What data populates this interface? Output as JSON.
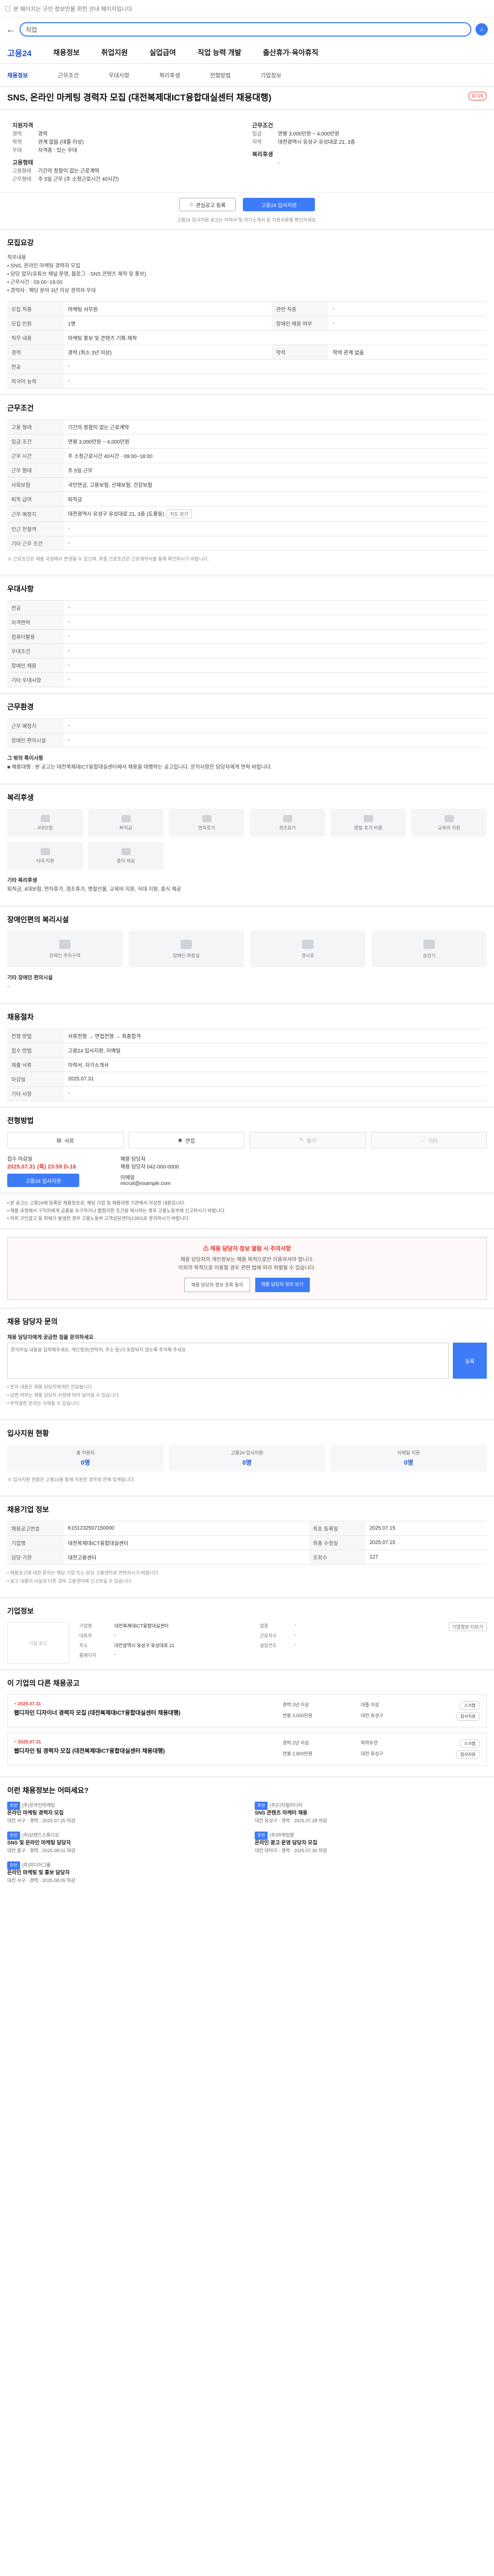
{
  "topbar": {
    "notice": "본 페이지는 구인 정보만을 위한 안내 페이지입니다"
  },
  "search": {
    "value": "직업"
  },
  "gnb": {
    "logo": "고용24",
    "items": [
      "채용정보",
      "취업지원",
      "실업급여",
      "직업 능력 개발",
      "출산휴가·육아휴직"
    ]
  },
  "subnav": {
    "items": [
      "채용정보",
      "근무조건",
      "우대사항",
      "복리후생",
      "전형방법",
      "기업정보"
    ]
  },
  "title": {
    "text": "SNS, 온라인 마케팅 경력자 모집 (대전복제대ICT융합대실센터 채용대행)",
    "dday": "D-16"
  },
  "summary": {
    "left_title": "지원자격",
    "left": [
      {
        "k": "경력",
        "v": "경력"
      },
      {
        "k": "학력",
        "v": "관계 없음 (대졸 이상)"
      },
      {
        "k": "우대",
        "v": "자격증 : 있는 우대"
      }
    ],
    "left2_title": "고용형태",
    "left2": [
      {
        "k": "고용형태",
        "v": "기간의 정함이 없는 근로계약"
      },
      {
        "k": "근무형태",
        "v": "주 5일 근무 (주 소정근로시간 40시간)"
      }
    ],
    "right_title": "근무조건",
    "right": [
      {
        "k": "임금",
        "v": "연봉 3,000만원 ~ 4,000만원"
      },
      {
        "k": "지역",
        "v": "대전광역시 유성구 유성대로 21, 3층"
      }
    ],
    "right2_title": "복리후생",
    "right2": [
      {
        "k": "",
        "v": "-"
      }
    ]
  },
  "apply": {
    "scrap": "관심공고 등록",
    "apply": "고용24 입사지원",
    "note": "고용24 입사지원 공고는 이력서 및 자기소개서 등 지원서류를 확인하세요."
  },
  "sections": {
    "recruit": {
      "title": "모집요강",
      "desc": [
        "직무내용",
        "• SNS, 온라인 마케팅 경력자 모집",
        "• 담당 업무(유튜브 채널 운영, 블로그 · SNS 콘텐츠 제작 및 홍보)",
        "• 근무시간 : 09:00~18:00",
        "• 경력자 : 해당 분야 3년 이상 경력자 우대"
      ],
      "rows": [
        {
          "k": "모집 직종",
          "v": "마케팅 사무원",
          "k2": "관련 직종",
          "v2": "-"
        },
        {
          "k": "모집 인원",
          "v": "1명",
          "k2": "장애인 채용 여부",
          "v2": "-"
        },
        {
          "k": "직무 내용",
          "v": "마케팅 홍보 및 콘텐츠 기획·제작",
          "k2": "",
          "v2": ""
        },
        {
          "k": "경력",
          "v": "경력 (최소 3년 이상)",
          "k2": "학력",
          "v2": "학력 관계 없음"
        },
        {
          "k": "전공",
          "v": "-",
          "k2": "",
          "v2": ""
        },
        {
          "k": "외국어 능력",
          "v": "-",
          "k2": "",
          "v2": ""
        }
      ]
    },
    "condition": {
      "title": "근무조건",
      "rows": [
        {
          "k": "고용 형태",
          "v": "기간의 정함이 없는 근로계약"
        },
        {
          "k": "임금 조건",
          "v": "연봉 3,000만원 ~ 4,000만원"
        },
        {
          "k": "근무 시간",
          "v": "주 소정근로시간 40시간 · 09:00~18:00"
        },
        {
          "k": "근무 형태",
          "v": "주 5일 근무"
        },
        {
          "k": "사회보험",
          "v": "국민연금, 고용보험, 산재보험, 건강보험"
        },
        {
          "k": "퇴직 급여",
          "v": "퇴직금"
        },
        {
          "k": "근무 예정지",
          "v": "대전광역시 유성구 유성대로 21, 3층 (도룡동)"
        },
        {
          "k": "인근 전철역",
          "v": "-"
        },
        {
          "k": "기타 근무 조건",
          "v": "-"
        }
      ],
      "note": "※ 근로조건은 채용 과정에서 변경될 수 있으며, 최종 근로조건은 근로계약서를 통해 확인하시기 바랍니다."
    },
    "prefer": {
      "title": "우대사항",
      "rows": [
        {
          "k": "전공",
          "v": "-"
        },
        {
          "k": "자격면허",
          "v": "-"
        },
        {
          "k": "컴퓨터활용",
          "v": "-"
        },
        {
          "k": "우대조건",
          "v": "-"
        },
        {
          "k": "장애인 채용",
          "v": "-"
        },
        {
          "k": "기타 우대사항",
          "v": "-"
        }
      ]
    },
    "env": {
      "title": "근무환경",
      "rows": [
        {
          "k": "근무 예정지",
          "v": "-"
        },
        {
          "k": "장애인 편의시설",
          "v": "-"
        }
      ],
      "sub": "그 밖의 특이사항",
      "sub_text": "■ 채용대행 : 본 공고는 대전복제대ICT융합대실센터에서 채용을 대행하는 공고입니다. 문의사항은 담당자에게 연락 바랍니다."
    },
    "welfare": {
      "title": "복리후생",
      "icons": [
        "4대보험",
        "퇴직금",
        "연차휴가",
        "경조휴가",
        "명절·휴가 비용",
        "교육비 지원",
        "식대 지원",
        "중식 제공"
      ],
      "sub": "기타 복리후생",
      "sub_text": "퇴직금, 4대보험, 연차휴가, 경조휴가, 명절선물, 교육비 지원, 식대 지원, 중식 제공"
    },
    "disabled": {
      "title": "장애인편의 복리시설",
      "icons": [
        "장애인 주차구역",
        "장애인 화장실",
        "경사로",
        "승강기"
      ],
      "sub": "기타 장애인 편의시설",
      "sub_text": "-"
    },
    "process": {
      "title": "채용절차",
      "rows": [
        {
          "k": "전형 방법",
          "v": "서류전형 → 면접전형 → 최종합격"
        },
        {
          "k": "접수 방법",
          "v": "고용24 입사지원, 이메일"
        },
        {
          "k": "제출 서류",
          "v": "이력서, 자기소개서"
        },
        {
          "k": "마감일",
          "v": "2025.07.31"
        },
        {
          "k": "기타 사항",
          "v": "-"
        }
      ]
    },
    "apply_method": {
      "title": "전형방법",
      "methods": [
        {
          "label": "서류",
          "off": false
        },
        {
          "label": "면접",
          "off": false
        },
        {
          "label": "필기",
          "off": true
        },
        {
          "label": "기타",
          "off": true
        }
      ],
      "deadline_label": "접수 마감일",
      "deadline": "2025.07.31 (목) 23:59",
      "dday": "D-16",
      "apply_btn": "고용24 입사지원",
      "contact_label": "채용 담당자",
      "contact": "채용 담당자 042-000-0000",
      "email_label": "이메일",
      "email": "recruit@example.com"
    },
    "notices": [
      "• 본 공고는 고용24에 등록된 채용정보로, 해당 기업 및 채용대행 기관에서 작성한 내용입니다.",
      "• 채용 과정에서 구직자에게 금품을 요구하거나 불합리한 조건을 제시하는 경우 고용노동부에 신고하시기 바랍니다.",
      "• 허위 구인광고 등 피해가 발생한 경우 고용노동부 고객상담센터(1350)로 문의하시기 바랍니다."
    ],
    "warning": {
      "title": "채용 담당자 정보 열람 시 주의사항",
      "text1": "채용 담당자의 개인정보는 채용 목적으로만 이용하셔야 합니다.",
      "text2": "이외의 목적으로 이용할 경우 관련 법에 따라 처벌될 수 있습니다.",
      "btn1": "채용 담당자 정보 조회 동의",
      "btn2": "채용 담당자 정보 보기"
    },
    "qna": {
      "title": "채용 담당자 문의",
      "label": "채용 담당자에게 궁금한 점을 문의하세요",
      "placeholder": "문의하실 내용을 입력해주세요. 개인정보(연락처, 주소 등)가 포함되지 않도록 주의해 주세요.",
      "register": "등록",
      "notes": [
        "• 문의 내용은 채용 담당자에게만 전달됩니다.",
        "• 답변 여부는 채용 담당자 사정에 따라 달라질 수 있습니다.",
        "• 부적절한 문의는 삭제될 수 있습니다."
      ]
    },
    "stats": {
      "title": "입사지원 현황",
      "items": [
        {
          "label": "총 지원자",
          "value": "0명"
        },
        {
          "label": "고용24 입사지원",
          "value": "0명"
        },
        {
          "label": "이메일 지원",
          "value": "0명"
        }
      ],
      "note": "※ 입사지원 현황은 고용24를 통해 지원한 경우에 한해 집계됩니다."
    },
    "info": {
      "title": "채용기업 정보",
      "rows": [
        {
          "k": "채용공고번호",
          "v": "K151232507150000",
          "k2": "최초 등록일",
          "v2": "2025.07.15"
        },
        {
          "k": "기업명",
          "v": "대전복제대ICT융합대실센터",
          "k2": "최종 수정일",
          "v2": "2025.07.15"
        },
        {
          "k": "담당 기관",
          "v": "대전고용센터",
          "k2": "조회수",
          "v2": "127"
        }
      ],
      "notes": [
        "• 채용공고에 대한 문의는 해당 기업 또는 담당 고용센터로 연락하시기 바랍니다.",
        "• 공고 내용이 사실과 다른 경우 고용센터에 신고하실 수 있습니다."
      ]
    },
    "company": {
      "title": "기업정보",
      "logo": "기업 로고",
      "rows": [
        {
          "k": "기업명",
          "v": "대전복제대ICT융합대실센터",
          "k2": "업종",
          "v2": "-"
        },
        {
          "k": "대표자",
          "v": "-",
          "k2": "근로자수",
          "v2": "-"
        },
        {
          "k": "주소",
          "v": "대전광역시 유성구 유성대로 21",
          "k2": "설립연도",
          "v2": "-"
        },
        {
          "k": "홈페이지",
          "v": "-",
          "k2": "",
          "v2": ""
        }
      ],
      "more": "기업정보 더보기"
    },
    "other_jobs": {
      "title": "이 기업의 다른 채용공고",
      "jobs": [
        {
          "date": "~ 2025.07.31",
          "title": "웹디자인 디자이너 경력자 모집 (대전복제대ICT융합대실센터 채용대행)",
          "a": "경력 3년 이상",
          "b": "대졸 이상",
          "c": "연봉 3,000만원",
          "d": "대전 유성구",
          "act1": "스크랩",
          "act2": "입사지원"
        },
        {
          "date": "~ 2025.07.31",
          "title": "웹디자인 팀 경력자 모집 (대전복제대ICT융합대실센터 채용대행)",
          "a": "경력 2년 이상",
          "b": "학력무관",
          "c": "연봉 2,800만원",
          "d": "대전 유성구",
          "act1": "스크랩",
          "act2": "입사지원"
        }
      ]
    },
    "recommend": {
      "title": "이런 채용정보는 어떠세요?",
      "items": [
        {
          "badge": "추천",
          "org": "(주)온라인마케팅",
          "title": "온라인 마케팅 경력자 모집",
          "meta": "대전 서구 · 경력 · 2025.07.25 마감"
        },
        {
          "badge": "추천",
          "org": "(주)디지털미디어",
          "title": "SNS 콘텐츠 마케터 채용",
          "meta": "대전 유성구 · 경력 · 2025.07.28 마감"
        },
        {
          "badge": "추천",
          "org": "(주)브랜드스튜디오",
          "title": "SNS 및 온라인 마케팅 담당자",
          "meta": "대전 중구 · 경력 · 2025.08.01 마감"
        },
        {
          "badge": "추천",
          "org": "(주)마케팅랩",
          "title": "온라인 광고 운영 담당자 모집",
          "meta": "대전 대덕구 · 경력 · 2025.07.30 마감"
        },
        {
          "badge": "추천",
          "org": "(주)미디어그룹",
          "title": "온라인 마케팅 및 홍보 담당자",
          "meta": "대전 서구 · 경력 · 2025.08.05 마감"
        }
      ]
    }
  }
}
